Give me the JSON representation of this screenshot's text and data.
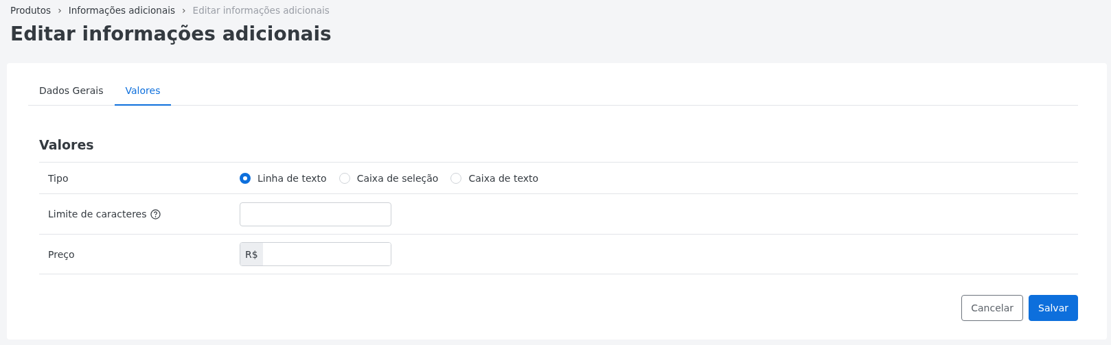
{
  "breadcrumb": [
    {
      "label": "Produtos",
      "current": false
    },
    {
      "label": "Informações adicionais",
      "current": false
    },
    {
      "label": "Editar informações adicionais",
      "current": true
    }
  ],
  "breadcrumb_separator": "›",
  "title": "Editar informações adicionais",
  "tabs": [
    {
      "label": "Dados Gerais",
      "selected": false
    },
    {
      "label": "Valores",
      "selected": true
    }
  ],
  "section_title": "Valores",
  "fields": [
    {
      "kind": "radio",
      "label": "Tipo",
      "options": [
        {
          "label": "Linha de texto",
          "selected": true
        },
        {
          "label": "Caixa de seleção",
          "selected": false
        },
        {
          "label": "Caixa de texto",
          "selected": false
        }
      ]
    },
    {
      "kind": "text",
      "label": "Limite de caracteres",
      "help": true
    },
    {
      "kind": "money",
      "label": "Preço",
      "prefix": "R$"
    }
  ],
  "buttons": [
    {
      "label": "Cancelar",
      "kind": "secondary"
    },
    {
      "label": "Salvar",
      "kind": "primary"
    }
  ]
}
